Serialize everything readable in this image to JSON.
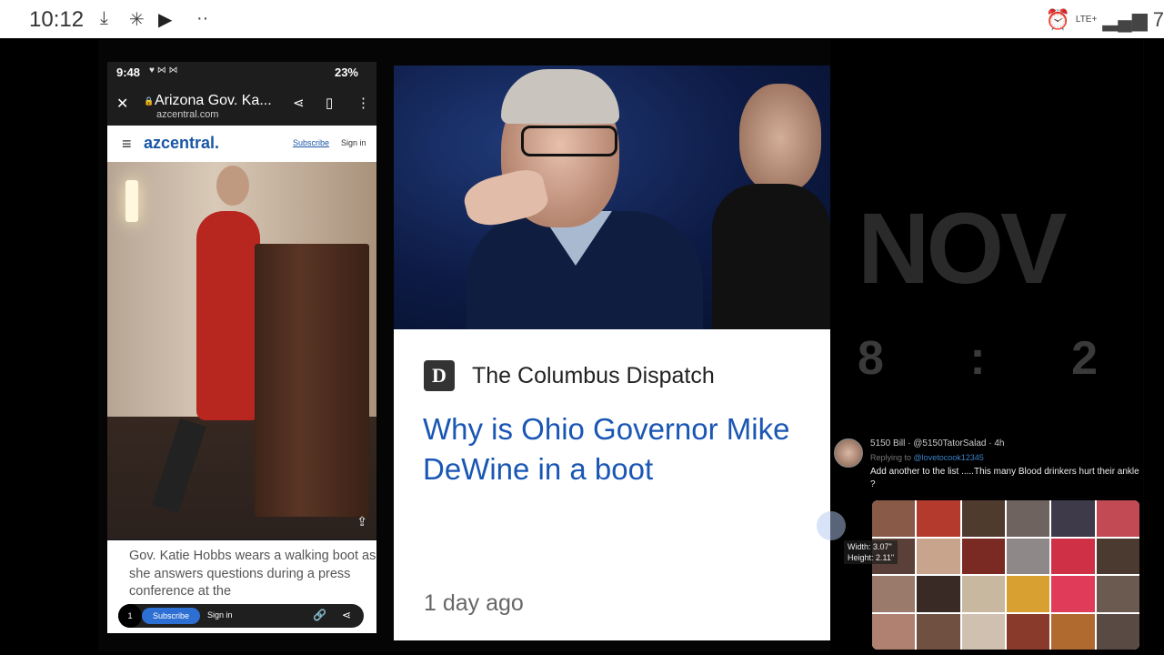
{
  "status_bar": {
    "time": "10:12",
    "network": "LTE+",
    "battery_partial": "7",
    "icons": [
      "download-icon",
      "app-icon",
      "youtube-icon",
      "more-dots-icon",
      "alarm-icon",
      "signal-icon"
    ]
  },
  "phone": {
    "status": {
      "time": "9:48",
      "battery": "23%"
    },
    "url_title": "Arizona Gov. Ka...",
    "url_domain": "azcentral.com",
    "site_logo": "azcentral.",
    "subscribe": "Subscribe",
    "sign_in": "Sign in",
    "caption": "Gov. Katie Hobbs wears a walking boot as she answers questions during a press conference at the",
    "bottom_bar": {
      "count": "1",
      "subscribe": "Subscribe",
      "sign_in": "Sign in"
    }
  },
  "card": {
    "publisher": "The Columbus Dispatch",
    "headline": "Why is Ohio Governor Mike DeWine in a boot",
    "age": "1 day ago"
  },
  "background": {
    "big_text": "NOV",
    "clock_digits": "8 : 2"
  },
  "tweet": {
    "header": "5150 Bill · @5150TatorSalad · 4h",
    "reply_prefix": "Replying to",
    "reply_handle": "@lovetocook12345",
    "body": "Add another to the list .....This many Blood drinkers hurt their ankle ?"
  },
  "measure": {
    "width": "Width: 3.07\"",
    "height": "Height: 2.11\""
  }
}
